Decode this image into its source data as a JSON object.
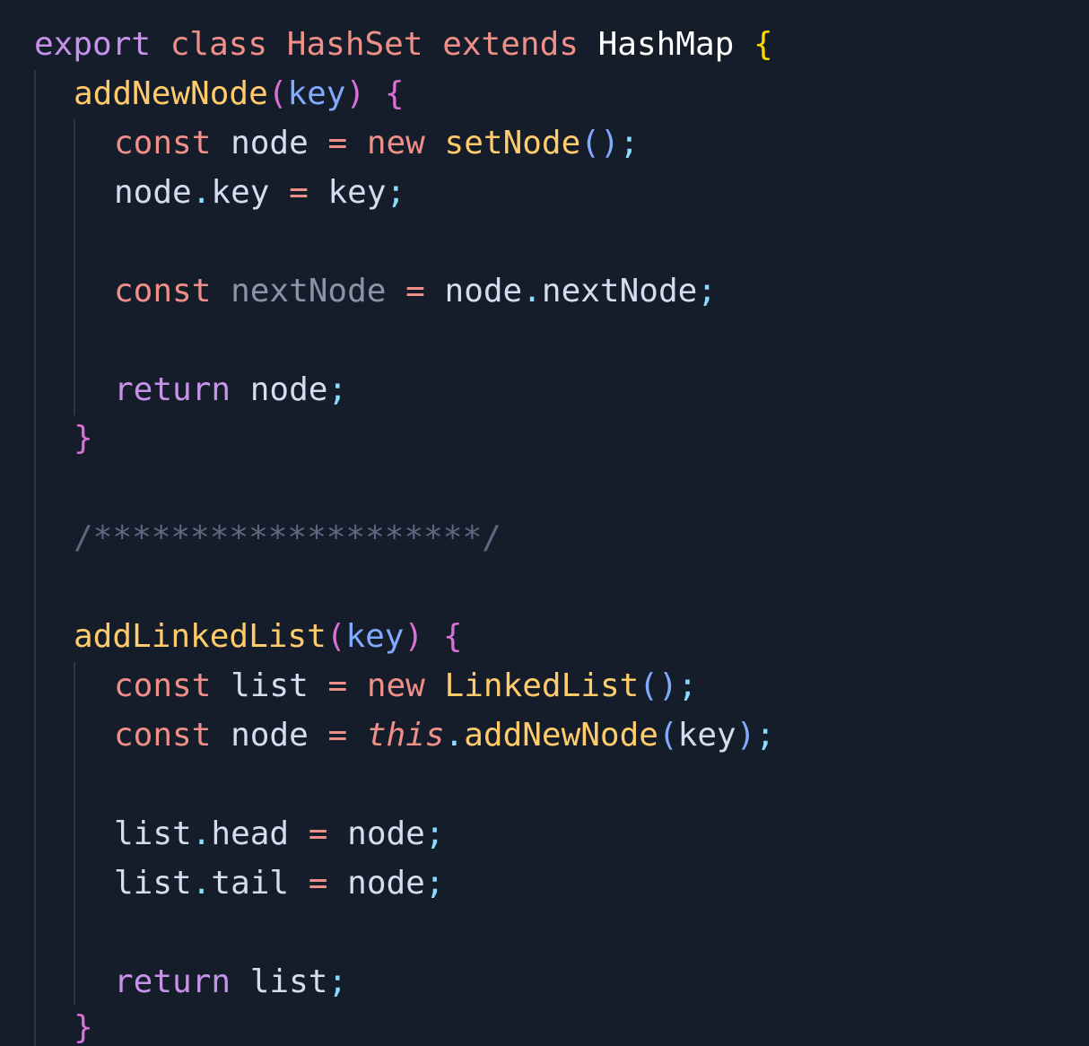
{
  "lines": {
    "l1": {
      "export": "export",
      "class": "class",
      "classname": "HashSet",
      "extends": "extends",
      "parent": "HashMap",
      "brace": "{"
    },
    "l2": {
      "method": "addNewNode",
      "open_paren": "(",
      "param": "key",
      "close_paren": ")",
      "brace": "{"
    },
    "l3": {
      "const": "const",
      "name": "node",
      "eq": "=",
      "new": "new",
      "ctor": "setNode",
      "parens": "()",
      "semi": ";"
    },
    "l4": {
      "obj": "node",
      "dot": ".",
      "prop": "key",
      "eq": "=",
      "value": "key",
      "semi": ";"
    },
    "l6": {
      "const": "const",
      "name": "nextNode",
      "eq": "=",
      "obj": "node",
      "dot": ".",
      "prop": "nextNode",
      "semi": ";"
    },
    "l8": {
      "return": "return",
      "value": "node",
      "semi": ";"
    },
    "l9": {
      "brace": "}"
    },
    "l11": {
      "comment": "/********************/"
    },
    "l13": {
      "method": "addLinkedList",
      "open_paren": "(",
      "param": "key",
      "close_paren": ")",
      "brace": "{"
    },
    "l14": {
      "const": "const",
      "name": "list",
      "eq": "=",
      "new": "new",
      "ctor": "LinkedList",
      "parens": "()",
      "semi": ";"
    },
    "l15": {
      "const": "const",
      "name": "node",
      "eq": "=",
      "this": "this",
      "dot": ".",
      "call": "addNewNode",
      "open_paren": "(",
      "arg": "key",
      "close_paren": ")",
      "semi": ";"
    },
    "l17": {
      "obj": "list",
      "dot": ".",
      "prop": "head",
      "eq": "=",
      "value": "node",
      "semi": ";"
    },
    "l18": {
      "obj": "list",
      "dot": ".",
      "prop": "tail",
      "eq": "=",
      "value": "node",
      "semi": ";"
    },
    "l20": {
      "return": "return",
      "value": "list",
      "semi": ";"
    },
    "l21": {
      "brace": "}"
    }
  }
}
